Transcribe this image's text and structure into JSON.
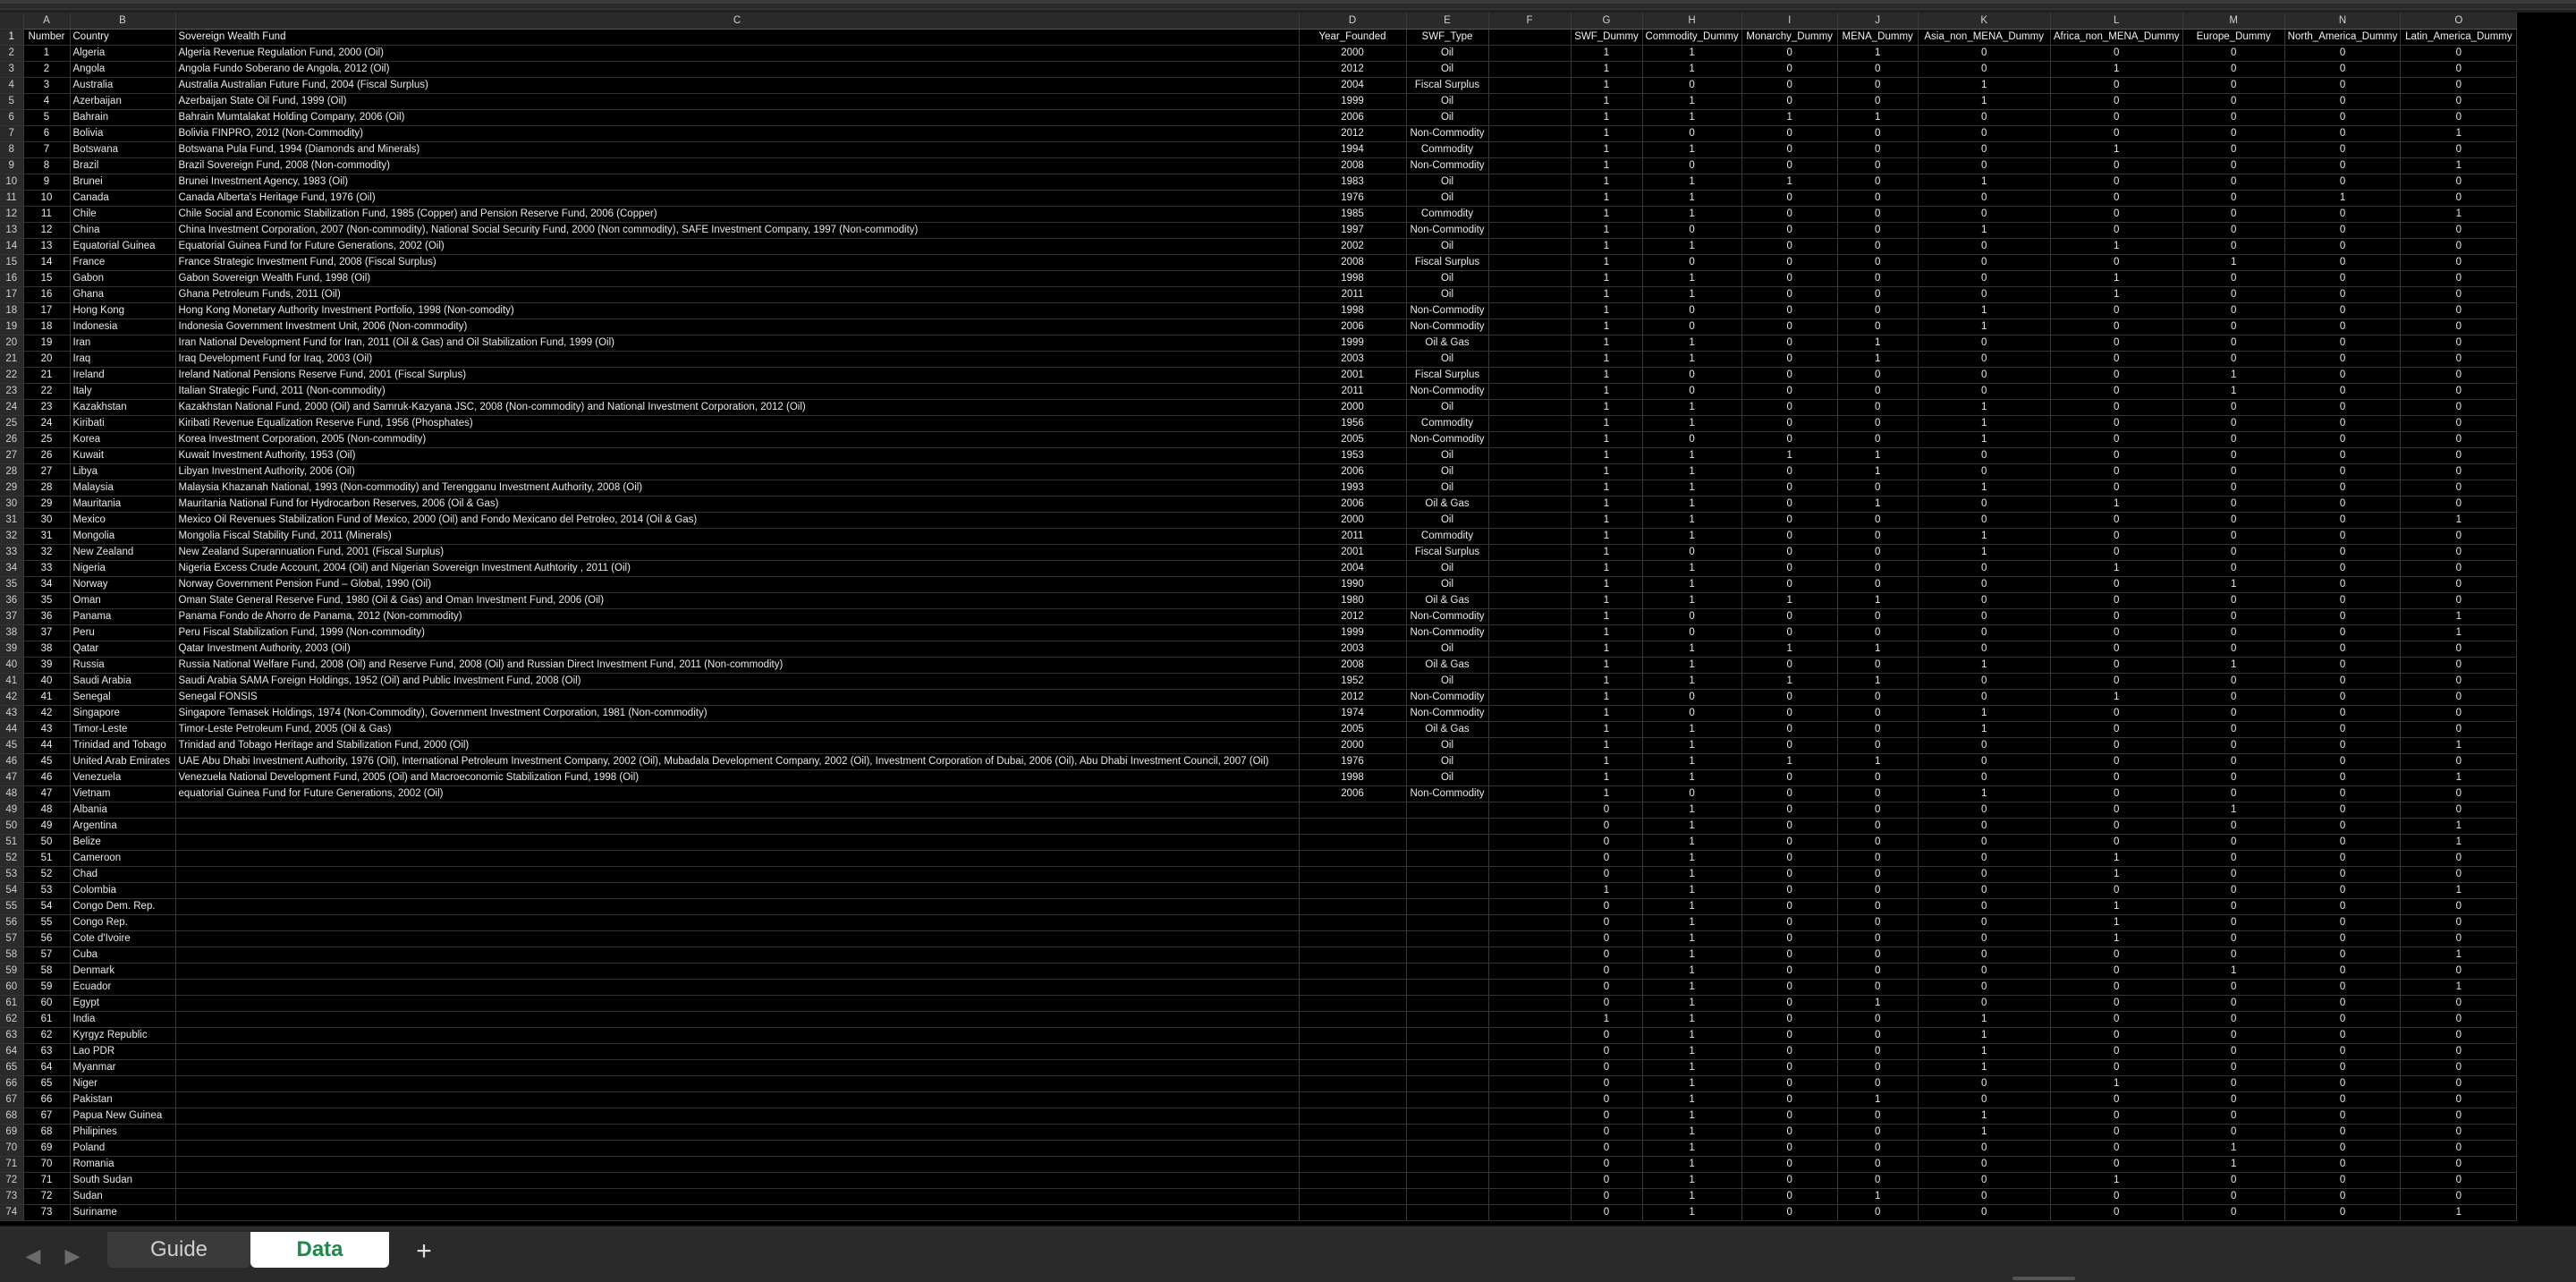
{
  "column_letters": [
    "A",
    "B",
    "C",
    "D",
    "E",
    "F",
    "G",
    "H",
    "I",
    "J",
    "K",
    "L",
    "M",
    "N",
    "O"
  ],
  "headers": [
    "Number",
    "Country",
    "Sovereign Wealth Fund",
    "Year_Founded",
    "SWF_Type",
    "",
    "SWF_Dummy",
    "Commodity_Dummy",
    "Monarchy_Dummy",
    "MENA_Dummy",
    "Asia_non_MENA_Dummy",
    "Africa_non_MENA_Dummy",
    "Europe_Dummy",
    "North_America_Dummy",
    "Latin_America_Dummy"
  ],
  "rows": [
    [
      "1",
      "Algeria",
      "Algeria Revenue Regulation Fund, 2000 (Oil)",
      "2000",
      "Oil",
      "",
      "1",
      "1",
      "0",
      "1",
      "0",
      "0",
      "0",
      "0",
      "0"
    ],
    [
      "2",
      "Angola",
      "Angola Fundo Soberano de Angola, 2012 (Oil)",
      "2012",
      "Oil",
      "",
      "1",
      "1",
      "0",
      "0",
      "0",
      "1",
      "0",
      "0",
      "0"
    ],
    [
      "3",
      "Australia",
      "Australia Australian Future Fund, 2004 (Fiscal Surplus)",
      "2004",
      "Fiscal Surplus",
      "",
      "1",
      "0",
      "0",
      "0",
      "1",
      "0",
      "0",
      "0",
      "0"
    ],
    [
      "4",
      "Azerbaijan",
      "Azerbaijan State Oil Fund, 1999 (Oil)",
      "1999",
      "Oil",
      "",
      "1",
      "1",
      "0",
      "0",
      "1",
      "0",
      "0",
      "0",
      "0"
    ],
    [
      "5",
      "Bahrain",
      "Bahrain Mumtalakat Holding Company, 2006 (Oil)",
      "2006",
      "Oil",
      "",
      "1",
      "1",
      "1",
      "1",
      "0",
      "0",
      "0",
      "0",
      "0"
    ],
    [
      "6",
      "Bolivia",
      "Bolivia FINPRO, 2012 (Non-Commodity)",
      "2012",
      "Non-Commodity",
      "",
      "1",
      "0",
      "0",
      "0",
      "0",
      "0",
      "0",
      "0",
      "1"
    ],
    [
      "7",
      "Botswana",
      "Botswana Pula Fund, 1994 (Diamonds and Minerals)",
      "1994",
      "Commodity",
      "",
      "1",
      "1",
      "0",
      "0",
      "0",
      "1",
      "0",
      "0",
      "0"
    ],
    [
      "8",
      "Brazil",
      "Brazil Sovereign Fund, 2008 (Non-commodity)",
      "2008",
      "Non-Commodity",
      "",
      "1",
      "0",
      "0",
      "0",
      "0",
      "0",
      "0",
      "0",
      "1"
    ],
    [
      "9",
      "Brunei",
      "Brunei Investment Agency, 1983 (Oil)",
      "1983",
      "Oil",
      "",
      "1",
      "1",
      "1",
      "0",
      "1",
      "0",
      "0",
      "0",
      "0"
    ],
    [
      "10",
      "Canada",
      "Canada Alberta's Heritage Fund, 1976 (Oil)",
      "1976",
      "Oil",
      "",
      "1",
      "1",
      "0",
      "0",
      "0",
      "0",
      "0",
      "1",
      "0"
    ],
    [
      "11",
      "Chile",
      "Chile Social and Economic Stabilization Fund, 1985 (Copper) and Pension Reserve Fund, 2006 (Copper)",
      "1985",
      "Commodity",
      "",
      "1",
      "1",
      "0",
      "0",
      "0",
      "0",
      "0",
      "0",
      "1"
    ],
    [
      "12",
      "China",
      "China Investment Corporation, 2007 (Non-commodity), National Social Security Fund, 2000 (Non commodity), SAFE Investment Company, 1997 (Non-commodity)",
      "1997",
      "Non-Commodity",
      "",
      "1",
      "0",
      "0",
      "0",
      "1",
      "0",
      "0",
      "0",
      "0"
    ],
    [
      "13",
      "Equatorial Guinea",
      "Equatorial Guinea Fund for Future Generations, 2002 (Oil)",
      "2002",
      "Oil",
      "",
      "1",
      "1",
      "0",
      "0",
      "0",
      "1",
      "0",
      "0",
      "0"
    ],
    [
      "14",
      "France",
      "France Strategic Investment Fund, 2008 (Fiscal Surplus)",
      "2008",
      "Fiscal Surplus",
      "",
      "1",
      "0",
      "0",
      "0",
      "0",
      "0",
      "1",
      "0",
      "0"
    ],
    [
      "15",
      "Gabon",
      "Gabon Sovereign Wealth Fund, 1998 (Oil)",
      "1998",
      "Oil",
      "",
      "1",
      "1",
      "0",
      "0",
      "0",
      "1",
      "0",
      "0",
      "0"
    ],
    [
      "16",
      "Ghana",
      "Ghana Petroleum Funds, 2011 (Oil)",
      "2011",
      "Oil",
      "",
      "1",
      "1",
      "0",
      "0",
      "0",
      "1",
      "0",
      "0",
      "0"
    ],
    [
      "17",
      "Hong Kong",
      "Hong Kong Monetary Authority Investment Portfolio, 1998 (Non-comodity)",
      "1998",
      "Non-Commodity",
      "",
      "1",
      "0",
      "0",
      "0",
      "1",
      "0",
      "0",
      "0",
      "0"
    ],
    [
      "18",
      "Indonesia",
      "Indonesia Government Investment Unit, 2006 (Non-commodity)",
      "2006",
      "Non-Commodity",
      "",
      "1",
      "0",
      "0",
      "0",
      "1",
      "0",
      "0",
      "0",
      "0"
    ],
    [
      "19",
      "Iran",
      "Iran National Development Fund for Iran, 2011 (Oil & Gas) and Oil Stabilization Fund, 1999 (Oil)",
      "1999",
      "Oil & Gas",
      "",
      "1",
      "1",
      "0",
      "1",
      "0",
      "0",
      "0",
      "0",
      "0"
    ],
    [
      "20",
      "Iraq",
      "Iraq Development Fund for Iraq, 2003 (Oil)",
      "2003",
      "Oil",
      "",
      "1",
      "1",
      "0",
      "1",
      "0",
      "0",
      "0",
      "0",
      "0"
    ],
    [
      "21",
      "Ireland",
      "Ireland National Pensions Reserve Fund, 2001 (Fiscal Surplus)",
      "2001",
      "Fiscal Surplus",
      "",
      "1",
      "0",
      "0",
      "0",
      "0",
      "0",
      "1",
      "0",
      "0"
    ],
    [
      "22",
      "Italy",
      "Italian Strategic Fund, 2011 (Non-commodity)",
      "2011",
      "Non-Commodity",
      "",
      "1",
      "0",
      "0",
      "0",
      "0",
      "0",
      "1",
      "0",
      "0"
    ],
    [
      "23",
      "Kazakhstan",
      "Kazakhstan National Fund, 2000 (Oil) and Samruk-Kazyana JSC, 2008 (Non-commodity) and National Investment Corporation, 2012 (Oil)",
      "2000",
      "Oil",
      "",
      "1",
      "1",
      "0",
      "0",
      "1",
      "0",
      "0",
      "0",
      "0"
    ],
    [
      "24",
      "Kiribati",
      "Kiribati Revenue Equalization Reserve Fund, 1956 (Phosphates)",
      "1956",
      "Commodity",
      "",
      "1",
      "1",
      "0",
      "0",
      "1",
      "0",
      "0",
      "0",
      "0"
    ],
    [
      "25",
      "Korea",
      "Korea Investment Corporation, 2005 (Non-commodity)",
      "2005",
      "Non-Commodity",
      "",
      "1",
      "0",
      "0",
      "0",
      "1",
      "0",
      "0",
      "0",
      "0"
    ],
    [
      "26",
      "Kuwait",
      "Kuwait Investment Authority, 1953 (Oil)",
      "1953",
      "Oil",
      "",
      "1",
      "1",
      "1",
      "1",
      "0",
      "0",
      "0",
      "0",
      "0"
    ],
    [
      "27",
      "Libya",
      "Libyan Investment Authority, 2006 (Oil)",
      "2006",
      "Oil",
      "",
      "1",
      "1",
      "0",
      "1",
      "0",
      "0",
      "0",
      "0",
      "0"
    ],
    [
      "28",
      "Malaysia",
      "Malaysia Khazanah National, 1993 (Non-commodity) and Terengganu Investment Authority, 2008 (Oil)",
      "1993",
      "Oil",
      "",
      "1",
      "1",
      "0",
      "0",
      "1",
      "0",
      "0",
      "0",
      "0"
    ],
    [
      "29",
      "Mauritania",
      "Mauritania National Fund for Hydrocarbon Reserves, 2006 (Oil & Gas)",
      "2006",
      "Oil & Gas",
      "",
      "1",
      "1",
      "0",
      "1",
      "0",
      "1",
      "0",
      "0",
      "0"
    ],
    [
      "30",
      "Mexico",
      "Mexico Oil Revenues Stabilization Fund of Mexico, 2000 (Oil) and Fondo Mexicano del Petroleo, 2014 (Oil & Gas)",
      "2000",
      "Oil",
      "",
      "1",
      "1",
      "0",
      "0",
      "0",
      "0",
      "0",
      "0",
      "1"
    ],
    [
      "31",
      "Mongolia",
      "Mongolia Fiscal Stability Fund, 2011 (Minerals)",
      "2011",
      "Commodity",
      "",
      "1",
      "1",
      "0",
      "0",
      "1",
      "0",
      "0",
      "0",
      "0"
    ],
    [
      "32",
      "New Zealand",
      "New Zealand Superannuation Fund, 2001 (Fiscal Surplus)",
      "2001",
      "Fiscal Surplus",
      "",
      "1",
      "0",
      "0",
      "0",
      "1",
      "0",
      "0",
      "0",
      "0"
    ],
    [
      "33",
      "Nigeria",
      "Nigeria Excess Crude Account, 2004 (Oil) and Nigerian Sovereign Investment Authtority , 2011 (Oil)",
      "2004",
      "Oil",
      "",
      "1",
      "1",
      "0",
      "0",
      "0",
      "1",
      "0",
      "0",
      "0"
    ],
    [
      "34",
      "Norway",
      "Norway Government Pension Fund – Global, 1990 (Oil)",
      "1990",
      "Oil",
      "",
      "1",
      "1",
      "0",
      "0",
      "0",
      "0",
      "1",
      "0",
      "0"
    ],
    [
      "35",
      "Oman",
      "Oman State General Reserve Fund, 1980 (Oil & Gas) and Oman Investment Fund, 2006 (Oil)",
      "1980",
      "Oil & Gas",
      "",
      "1",
      "1",
      "1",
      "1",
      "0",
      "0",
      "0",
      "0",
      "0"
    ],
    [
      "36",
      "Panama",
      "Panama Fondo de Ahorro de Panama, 2012 (Non-commodity)",
      "2012",
      "Non-Commodity",
      "",
      "1",
      "0",
      "0",
      "0",
      "0",
      "0",
      "0",
      "0",
      "1"
    ],
    [
      "37",
      "Peru",
      "Peru Fiscal Stabilization Fund, 1999 (Non-commodity)",
      "1999",
      "Non-Commodity",
      "",
      "1",
      "0",
      "0",
      "0",
      "0",
      "0",
      "0",
      "0",
      "1"
    ],
    [
      "38",
      "Qatar",
      "Qatar Investment Authority, 2003 (Oil)",
      "2003",
      "Oil",
      "",
      "1",
      "1",
      "1",
      "1",
      "0",
      "0",
      "0",
      "0",
      "0"
    ],
    [
      "39",
      "Russia",
      "Russia National Welfare Fund, 2008 (Oil) and Reserve Fund, 2008 (Oil) and Russian Direct Investment Fund, 2011 (Non-commodity)",
      "2008",
      "Oil & Gas",
      "",
      "1",
      "1",
      "0",
      "0",
      "1",
      "0",
      "1",
      "0",
      "0"
    ],
    [
      "40",
      "Saudi Arabia",
      "Saudi Arabia SAMA Foreign Holdings, 1952 (Oil) and Public Investment Fund, 2008 (Oil)",
      "1952",
      "Oil",
      "",
      "1",
      "1",
      "1",
      "1",
      "0",
      "0",
      "0",
      "0",
      "0"
    ],
    [
      "41",
      "Senegal",
      "Senegal FONSIS",
      "2012",
      "Non-Commodity",
      "",
      "1",
      "0",
      "0",
      "0",
      "0",
      "1",
      "0",
      "0",
      "0"
    ],
    [
      "42",
      "Singapore",
      "Singapore Temasek Holdings, 1974 (Non-Commodity), Government Investment Corporation, 1981 (Non-commodity)",
      "1974",
      "Non-Commodity",
      "",
      "1",
      "0",
      "0",
      "0",
      "1",
      "0",
      "0",
      "0",
      "0"
    ],
    [
      "43",
      "Timor-Leste",
      "Timor-Leste Petroleum Fund, 2005 (Oil & Gas)",
      "2005",
      "Oil & Gas",
      "",
      "1",
      "1",
      "0",
      "0",
      "1",
      "0",
      "0",
      "0",
      "0"
    ],
    [
      "44",
      "Trinidad and Tobago",
      "Trinidad and Tobago Heritage and Stabilization Fund, 2000 (Oil)",
      "2000",
      "Oil",
      "",
      "1",
      "1",
      "0",
      "0",
      "0",
      "0",
      "0",
      "0",
      "1"
    ],
    [
      "45",
      "United Arab Emirates",
      "UAE Abu Dhabi Investment Authority, 1976 (Oil), International Petroleum Investment Company, 2002 (Oil), Mubadala Development Company, 2002 (Oil), Investment Corporation of Dubai, 2006 (Oil), Abu Dhabi Investment Council, 2007 (Oil)",
      "1976",
      "Oil",
      "",
      "1",
      "1",
      "1",
      "1",
      "0",
      "0",
      "0",
      "0",
      "0"
    ],
    [
      "46",
      "Venezuela",
      "Venezuela National Development Fund, 2005 (Oil) and Macroeconomic Stabilization Fund, 1998 (Oil)",
      "1998",
      "Oil",
      "",
      "1",
      "1",
      "0",
      "0",
      "0",
      "0",
      "0",
      "0",
      "1"
    ],
    [
      "47",
      "Vietnam",
      "equatorial Guinea Fund for Future Generations, 2002 (Oil)",
      "2006",
      "Non-Commodity",
      "",
      "1",
      "0",
      "0",
      "0",
      "1",
      "0",
      "0",
      "0",
      "0"
    ],
    [
      "48",
      "Albania",
      "",
      "",
      "",
      "",
      "0",
      "1",
      "0",
      "0",
      "0",
      "0",
      "1",
      "0",
      "0"
    ],
    [
      "49",
      "Argentina",
      "",
      "",
      "",
      "",
      "0",
      "1",
      "0",
      "0",
      "0",
      "0",
      "0",
      "0",
      "1"
    ],
    [
      "50",
      "Belize",
      "",
      "",
      "",
      "",
      "0",
      "1",
      "0",
      "0",
      "0",
      "0",
      "0",
      "0",
      "1"
    ],
    [
      "51",
      "Cameroon",
      "",
      "",
      "",
      "",
      "0",
      "1",
      "0",
      "0",
      "0",
      "1",
      "0",
      "0",
      "0"
    ],
    [
      "52",
      "Chad",
      "",
      "",
      "",
      "",
      "0",
      "1",
      "0",
      "0",
      "0",
      "1",
      "0",
      "0",
      "0"
    ],
    [
      "53",
      "Colombia",
      "",
      "",
      "",
      "",
      "1",
      "1",
      "0",
      "0",
      "0",
      "0",
      "0",
      "0",
      "1"
    ],
    [
      "54",
      "Congo Dem. Rep.",
      "",
      "",
      "",
      "",
      "0",
      "1",
      "0",
      "0",
      "0",
      "1",
      "0",
      "0",
      "0"
    ],
    [
      "55",
      "Congo Rep.",
      "",
      "",
      "",
      "",
      "0",
      "1",
      "0",
      "0",
      "0",
      "1",
      "0",
      "0",
      "0"
    ],
    [
      "56",
      "Cote d'Ivoire",
      "",
      "",
      "",
      "",
      "0",
      "1",
      "0",
      "0",
      "0",
      "1",
      "0",
      "0",
      "0"
    ],
    [
      "57",
      "Cuba",
      "",
      "",
      "",
      "",
      "0",
      "1",
      "0",
      "0",
      "0",
      "0",
      "0",
      "0",
      "1"
    ],
    [
      "58",
      "Denmark",
      "",
      "",
      "",
      "",
      "0",
      "1",
      "0",
      "0",
      "0",
      "0",
      "1",
      "0",
      "0"
    ],
    [
      "59",
      "Ecuador",
      "",
      "",
      "",
      "",
      "0",
      "1",
      "0",
      "0",
      "0",
      "0",
      "0",
      "0",
      "1"
    ],
    [
      "60",
      "Egypt",
      "",
      "",
      "",
      "",
      "0",
      "1",
      "0",
      "1",
      "0",
      "0",
      "0",
      "0",
      "0"
    ],
    [
      "61",
      "India",
      "",
      "",
      "",
      "",
      "1",
      "1",
      "0",
      "0",
      "1",
      "0",
      "0",
      "0",
      "0"
    ],
    [
      "62",
      "Kyrgyz Republic",
      "",
      "",
      "",
      "",
      "0",
      "1",
      "0",
      "0",
      "1",
      "0",
      "0",
      "0",
      "0"
    ],
    [
      "63",
      "Lao PDR",
      "",
      "",
      "",
      "",
      "0",
      "1",
      "0",
      "0",
      "1",
      "0",
      "0",
      "0",
      "0"
    ],
    [
      "64",
      "Myanmar",
      "",
      "",
      "",
      "",
      "0",
      "1",
      "0",
      "0",
      "1",
      "0",
      "0",
      "0",
      "0"
    ],
    [
      "65",
      "Niger",
      "",
      "",
      "",
      "",
      "0",
      "1",
      "0",
      "0",
      "0",
      "1",
      "0",
      "0",
      "0"
    ],
    [
      "66",
      "Pakistan",
      "",
      "",
      "",
      "",
      "0",
      "1",
      "0",
      "1",
      "0",
      "0",
      "0",
      "0",
      "0"
    ],
    [
      "67",
      "Papua New Guinea",
      "",
      "",
      "",
      "",
      "0",
      "1",
      "0",
      "0",
      "1",
      "0",
      "0",
      "0",
      "0"
    ],
    [
      "68",
      "Philipines",
      "",
      "",
      "",
      "",
      "0",
      "1",
      "0",
      "0",
      "1",
      "0",
      "0",
      "0",
      "0"
    ],
    [
      "69",
      "Poland",
      "",
      "",
      "",
      "",
      "0",
      "1",
      "0",
      "0",
      "0",
      "0",
      "1",
      "0",
      "0"
    ],
    [
      "70",
      "Romania",
      "",
      "",
      "",
      "",
      "0",
      "1",
      "0",
      "0",
      "0",
      "0",
      "1",
      "0",
      "0"
    ],
    [
      "71",
      "South Sudan",
      "",
      "",
      "",
      "",
      "0",
      "1",
      "0",
      "0",
      "0",
      "1",
      "0",
      "0",
      "0"
    ],
    [
      "72",
      "Sudan",
      "",
      "",
      "",
      "",
      "0",
      "1",
      "0",
      "1",
      "0",
      "0",
      "0",
      "0",
      "0"
    ],
    [
      "73",
      "Suriname",
      "",
      "",
      "",
      "",
      "0",
      "1",
      "0",
      "0",
      "0",
      "0",
      "0",
      "0",
      "1"
    ]
  ],
  "tabs": {
    "guide": "Guide",
    "data": "Data",
    "add": "+"
  },
  "nav": {
    "prev": "◀",
    "next": "▶"
  },
  "colors": {
    "active_tab_text": "#1e8a4a",
    "grid_bg": "#000000",
    "header_bg": "#2a2a2a"
  }
}
